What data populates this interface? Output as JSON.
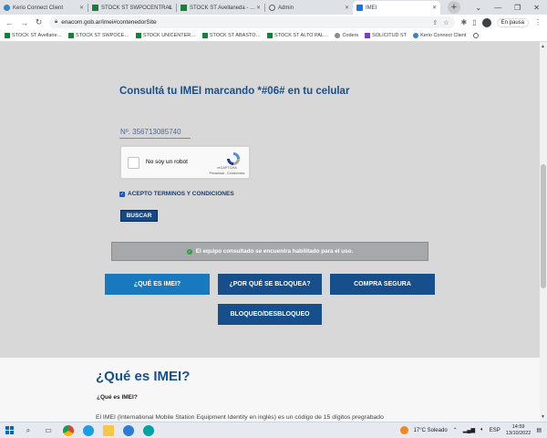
{
  "browser": {
    "tabs": [
      {
        "title": "Kerio Connect Client",
        "favicon_color": "#3b82c4",
        "active": false
      },
      {
        "title": "STOCK ST SWPOCENTRAL",
        "favicon_color": "#188038",
        "active": false
      },
      {
        "title": "STOCK ST Avellaneda - …",
        "favicon_color": "#188038",
        "active": false
      },
      {
        "title": "Admin",
        "favicon_color": "#5f6368",
        "active": false
      },
      {
        "title": "IMEI",
        "favicon_color": "#1a73e8",
        "active": true
      }
    ],
    "url": "enacom.gob.ar/imei#contenedorSite",
    "profile_status": "En pausa"
  },
  "bookmarks": [
    {
      "label": "STOCK ST Avellane…",
      "color": "#188038"
    },
    {
      "label": "STOCK ST SWPOCE…",
      "color": "#188038"
    },
    {
      "label": "STOCK UNICENTER…",
      "color": "#188038"
    },
    {
      "label": "STOCK ST ABASTO…",
      "color": "#188038"
    },
    {
      "label": "STOCK ST ALTO PAL…",
      "color": "#188038"
    },
    {
      "label": "Coders",
      "color": "#8a8a8a"
    },
    {
      "label": "SOLICITUD ST",
      "color": "#7b3fbf"
    },
    {
      "label": "Kerio Connect Client",
      "color": "#3b82c4"
    }
  ],
  "page": {
    "heading": "Consultá tu IMEI marcando *#06# en tu celular",
    "imei_value": "Nº. 356713085740",
    "recaptcha": {
      "label": "No soy un robot",
      "brand": "reCAPTCHA",
      "terms": "Privacidad - Condiciones"
    },
    "terms_label": "ACEPTO TERMINOS Y CONDICIONES",
    "search_button": "BUSCAR",
    "status_message": "El equipo consultado se encuentra habilitado para el uso.",
    "buttons": {
      "que_es": "¿QUÉ ES IMEI?",
      "por_que": "¿POR QUÉ SE BLOQUEA?",
      "compra": "COMPRA SEGURA",
      "bloqueo": "BLOQUEO/DESBLOQUEO"
    },
    "section_title": "¿Qué es IMEI?",
    "section_subtitle": "¿Qué es IMEI?",
    "section_body": "El IMEI (International Mobile Station Equipment Identity en inglés) es un código de 15 dígitos pregrabado"
  },
  "taskbar": {
    "weather": "17°C  Soleado",
    "language": "ESP",
    "time": "14:59",
    "date": "13/10/2022"
  },
  "colors": {
    "accent": "#174f8d",
    "accent_light": "#1979be",
    "status_bg": "#a7a8aa",
    "heading": "#1a4f8a"
  }
}
